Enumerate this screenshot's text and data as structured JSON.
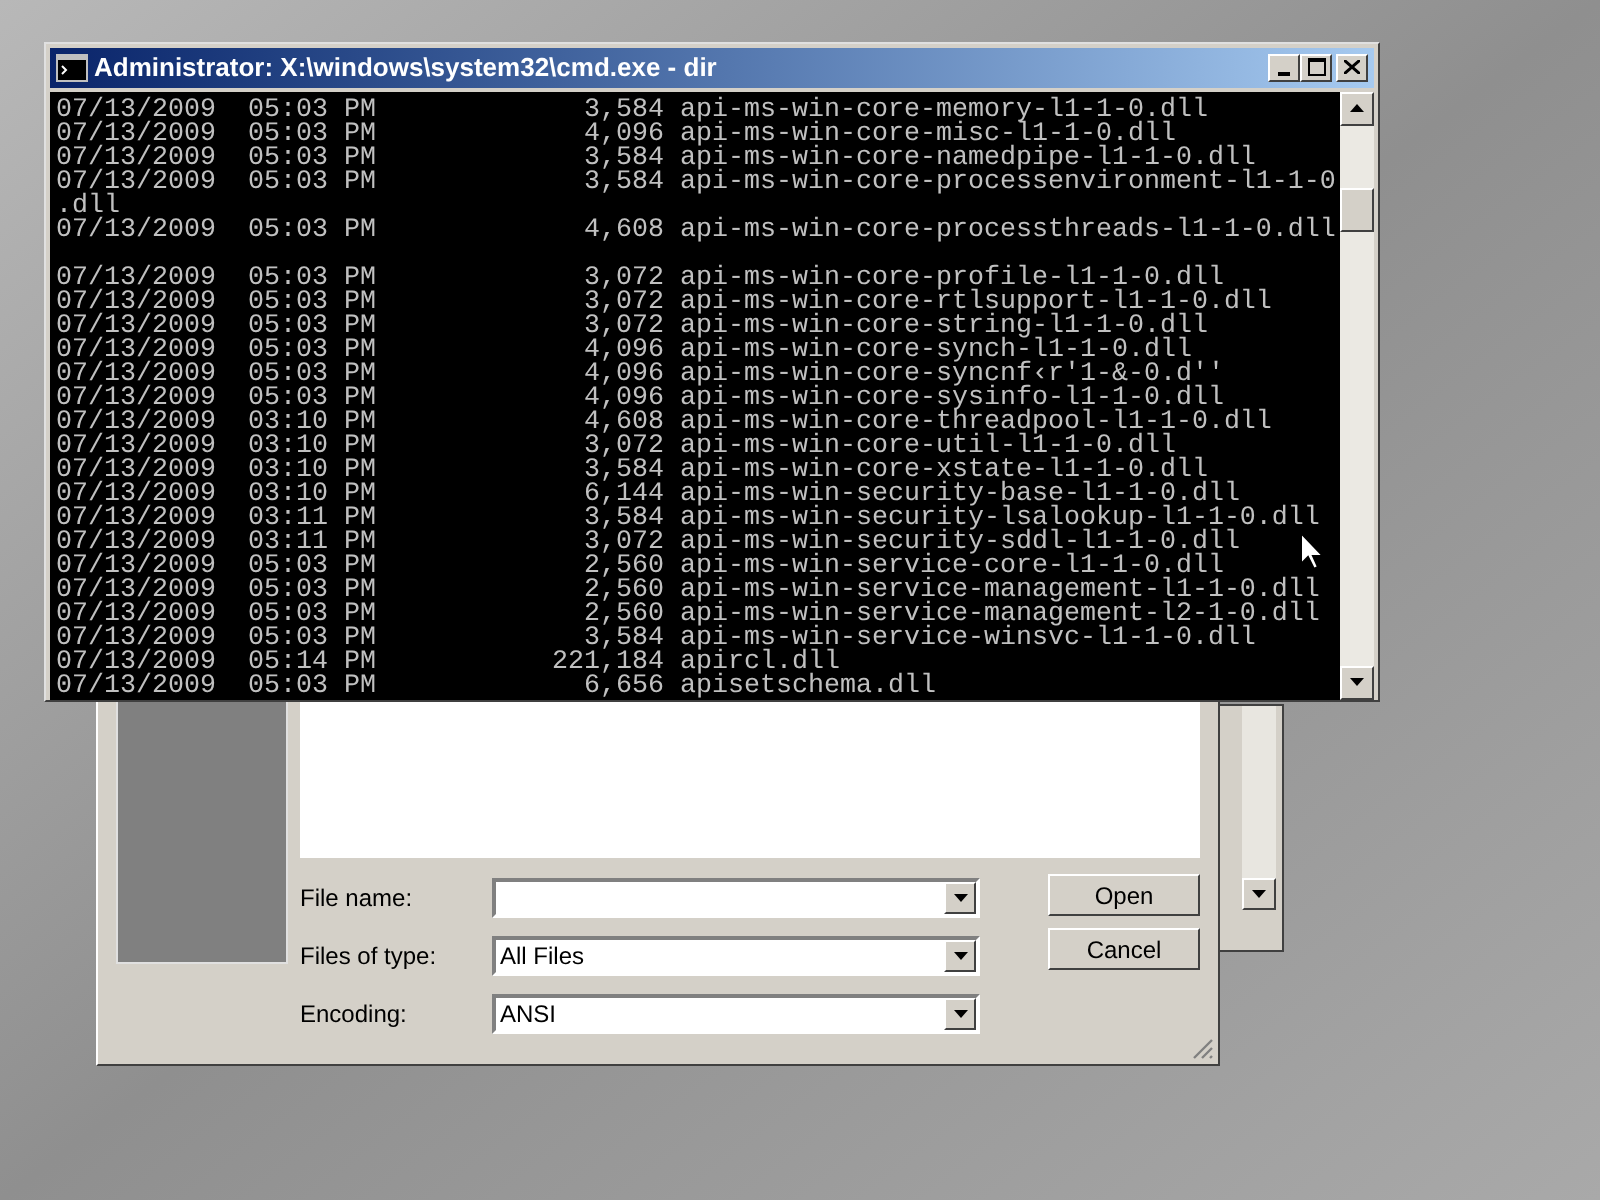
{
  "console": {
    "title": "Administrator: X:\\windows\\system32\\cmd.exe - dir",
    "lines": [
      {
        "kind": "entry",
        "date": "07/13/2009",
        "time": "05:03",
        "ampm": "PM",
        "size": "3,584",
        "name": "api-ms-win-core-memory-l1-1-0.dll"
      },
      {
        "kind": "entry",
        "date": "07/13/2009",
        "time": "05:03",
        "ampm": "PM",
        "size": "4,096",
        "name": "api-ms-win-core-misc-l1-1-0.dll"
      },
      {
        "kind": "entry",
        "date": "07/13/2009",
        "time": "05:03",
        "ampm": "PM",
        "size": "3,584",
        "name": "api-ms-win-core-namedpipe-l1-1-0.dll"
      },
      {
        "kind": "entry",
        "date": "07/13/2009",
        "time": "05:03",
        "ampm": "PM",
        "size": "3,584",
        "name": "api-ms-win-core-processenvironment-l1-1-0"
      },
      {
        "kind": "wrap",
        "name": ".dll"
      },
      {
        "kind": "entry",
        "date": "07/13/2009",
        "time": "05:03",
        "ampm": "PM",
        "size": "4,608",
        "name": "api-ms-win-core-processthreads-l1-1-0.dll"
      },
      {
        "kind": "blank"
      },
      {
        "kind": "entry",
        "date": "07/13/2009",
        "time": "05:03",
        "ampm": "PM",
        "size": "3,072",
        "name": "api-ms-win-core-profile-l1-1-0.dll"
      },
      {
        "kind": "entry",
        "date": "07/13/2009",
        "time": "05:03",
        "ampm": "PM",
        "size": "3,072",
        "name": "api-ms-win-core-rtlsupport-l1-1-0.dll"
      },
      {
        "kind": "entry",
        "date": "07/13/2009",
        "time": "05:03",
        "ampm": "PM",
        "size": "3,072",
        "name": "api-ms-win-core-string-l1-1-0.dll"
      },
      {
        "kind": "entry",
        "date": "07/13/2009",
        "time": "05:03",
        "ampm": "PM",
        "size": "4,096",
        "name": "api-ms-win-core-synch-l1-1-0.dll"
      },
      {
        "kind": "entry",
        "date": "07/13/2009",
        "time": "05:03",
        "ampm": "PM",
        "size": "4,096",
        "name": "api-ms-win-core-syncnf‹r'1-&-0.d''"
      },
      {
        "kind": "entry",
        "date": "07/13/2009",
        "time": "05:03",
        "ampm": "PM",
        "size": "4,096",
        "name": "api-ms-win-core-sysinfo-l1-1-0.dll"
      },
      {
        "kind": "entry",
        "date": "07/13/2009",
        "time": "03:10",
        "ampm": "PM",
        "size": "4,608",
        "name": "api-ms-win-core-threadpool-l1-1-0.dll"
      },
      {
        "kind": "entry",
        "date": "07/13/2009",
        "time": "03:10",
        "ampm": "PM",
        "size": "3,072",
        "name": "api-ms-win-core-util-l1-1-0.dll"
      },
      {
        "kind": "entry",
        "date": "07/13/2009",
        "time": "03:10",
        "ampm": "PM",
        "size": "3,584",
        "name": "api-ms-win-core-xstate-l1-1-0.dll"
      },
      {
        "kind": "entry",
        "date": "07/13/2009",
        "time": "03:10",
        "ampm": "PM",
        "size": "6,144",
        "name": "api-ms-win-security-base-l1-1-0.dll"
      },
      {
        "kind": "entry",
        "date": "07/13/2009",
        "time": "03:11",
        "ampm": "PM",
        "size": "3,584",
        "name": "api-ms-win-security-lsalookup-l1-1-0.dll"
      },
      {
        "kind": "entry",
        "date": "07/13/2009",
        "time": "03:11",
        "ampm": "PM",
        "size": "3,072",
        "name": "api-ms-win-security-sddl-l1-1-0.dll"
      },
      {
        "kind": "entry",
        "date": "07/13/2009",
        "time": "05:03",
        "ampm": "PM",
        "size": "2,560",
        "name": "api-ms-win-service-core-l1-1-0.dll"
      },
      {
        "kind": "entry",
        "date": "07/13/2009",
        "time": "05:03",
        "ampm": "PM",
        "size": "2,560",
        "name": "api-ms-win-service-management-l1-1-0.dll"
      },
      {
        "kind": "entry",
        "date": "07/13/2009",
        "time": "05:03",
        "ampm": "PM",
        "size": "2,560",
        "name": "api-ms-win-service-management-l2-1-0.dll"
      },
      {
        "kind": "entry",
        "date": "07/13/2009",
        "time": "05:03",
        "ampm": "PM",
        "size": "3,584",
        "name": "api-ms-win-service-winsvc-l1-1-0.dll"
      },
      {
        "kind": "entry",
        "date": "07/13/2009",
        "time": "05:14",
        "ampm": "PM",
        "size": "221,184",
        "name": "apircl.dll"
      },
      {
        "kind": "entry",
        "date": "07/13/2009",
        "time": "05:03",
        "ampm": "PM",
        "size": "6,656",
        "name": "apisetschema.dll"
      }
    ]
  },
  "open_dialog": {
    "fields": [
      {
        "label": "File name:"
      },
      {
        "label": "Files of type:",
        "value": "All Files"
      },
      {
        "label": "Encoding:",
        "value": "ANSI"
      }
    ],
    "buttons": [
      "Open",
      "Cancel"
    ]
  }
}
